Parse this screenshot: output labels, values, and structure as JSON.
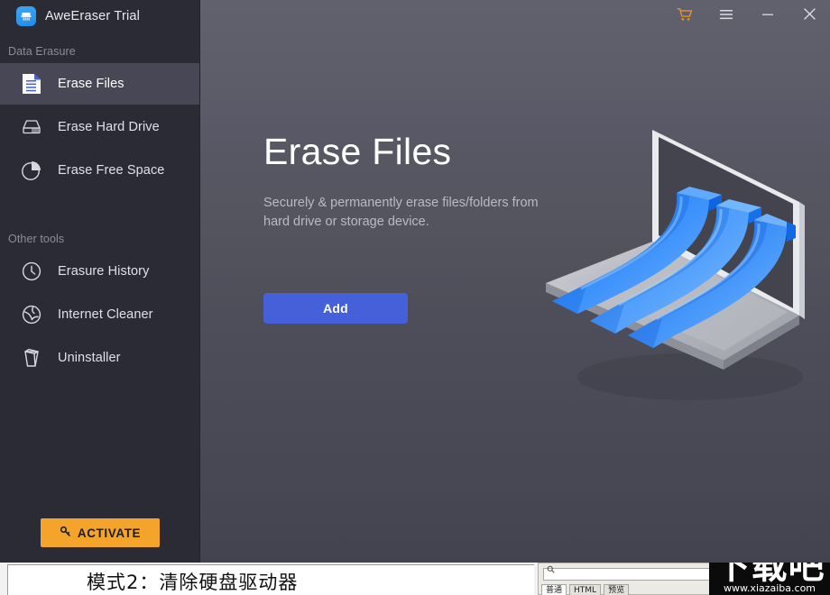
{
  "app": {
    "brand_title": "AweEraser Trial",
    "brand_icon": "eraser-app-icon"
  },
  "titlebar": {
    "buttons": [
      {
        "name": "cart-icon",
        "glyph": "\u0000"
      },
      {
        "name": "menu-icon",
        "glyph": "\u0000"
      },
      {
        "name": "minimize-icon",
        "glyph": "\u0000"
      },
      {
        "name": "close-icon",
        "glyph": "\u0000"
      }
    ]
  },
  "sidebar": {
    "section_data_erasure": "Data Erasure",
    "section_other_tools": "Other tools",
    "data_erasure_items": [
      {
        "label": "Erase Files",
        "icon": "document-icon",
        "active": true
      },
      {
        "label": "Erase Hard Drive",
        "icon": "hard-drive-icon",
        "active": false
      },
      {
        "label": "Erase Free Space",
        "icon": "pie-chart-icon",
        "active": false
      }
    ],
    "other_tools_items": [
      {
        "label": "Erasure History",
        "icon": "clock-icon",
        "active": false
      },
      {
        "label": "Internet Cleaner",
        "icon": "globe-icon",
        "active": false
      },
      {
        "label": "Uninstaller",
        "icon": "trash-can-icon",
        "active": false
      }
    ],
    "activate_label": "ACTIVATE",
    "activate_icon": "key-icon"
  },
  "main": {
    "title": "Erase Files",
    "subtitle": "Securely & permanently erase files/folders from hard drive or storage device.",
    "add_label": "Add",
    "illustration": "isometric-laptop-with-data-ribbons"
  },
  "background_window": {
    "caption_text": "模式2：清除硬盘驱动器",
    "search_glyph": "\u0000",
    "tabs": [
      "普通",
      "HTML",
      "预览"
    ]
  },
  "watermark": {
    "cjk": "下载吧",
    "url": "www.xiazaiba.com"
  },
  "colors": {
    "sidebar_bg": "#2b2b36",
    "sidebar_active": "#474755",
    "content_top": "#61616e",
    "content_bottom": "#434350",
    "accent_blue": "#4560d8",
    "accent_orange": "#f4a42a",
    "brand_blue": "#2b92ee"
  }
}
